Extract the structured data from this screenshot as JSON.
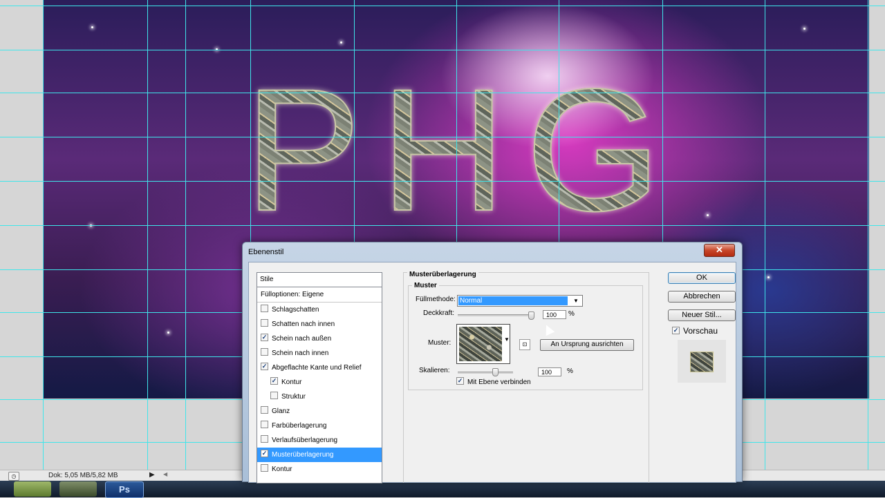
{
  "canvas": {
    "artwork_text": "PHG"
  },
  "statusbar": {
    "doc_info": "Dok: 5,05 MB/5,82 MB"
  },
  "taskbar": {
    "photoshop_label": "Ps"
  },
  "dialog": {
    "title": "Ebenenstil",
    "close_label": "✕",
    "styles_header": "Stile",
    "fill_options": "Fülloptionen: Eigene",
    "styles": [
      {
        "label": "Schlagschatten",
        "checked": false
      },
      {
        "label": "Schatten nach innen",
        "checked": false
      },
      {
        "label": "Schein nach außen",
        "checked": true
      },
      {
        "label": "Schein nach innen",
        "checked": false
      },
      {
        "label": "Abgeflachte Kante und Relief",
        "checked": true
      },
      {
        "label": "Kontur",
        "checked": true
      },
      {
        "label": "Struktur",
        "checked": false
      },
      {
        "label": "Glanz",
        "checked": false
      },
      {
        "label": "Farbüberlagerung",
        "checked": false
      },
      {
        "label": "Verlaufsüberlagerung",
        "checked": false
      },
      {
        "label": "Musterüberlagerung",
        "checked": true,
        "selected": true
      },
      {
        "label": "Kontur",
        "checked": false
      }
    ],
    "section_title": "Musterüberlagerung",
    "group_title": "Muster",
    "blend_mode_label": "Füllmethode:",
    "blend_mode_value": "Normal",
    "opacity_label": "Deckkraft:",
    "opacity_value": "100",
    "opacity_unit": "%",
    "pattern_label": "Muster:",
    "snap_origin_label": "An Ursprung ausrichten",
    "scale_label": "Skalieren:",
    "scale_value": "100",
    "scale_unit": "%",
    "link_layer_label": "Mit Ebene verbinden",
    "link_layer_checked": true,
    "ok_label": "OK",
    "cancel_label": "Abbrechen",
    "new_style_label": "Neuer Stil...",
    "preview_label": "Vorschau",
    "preview_checked": true
  },
  "colors": {
    "guide": "#3fe6ea",
    "selection": "#3399ff"
  }
}
